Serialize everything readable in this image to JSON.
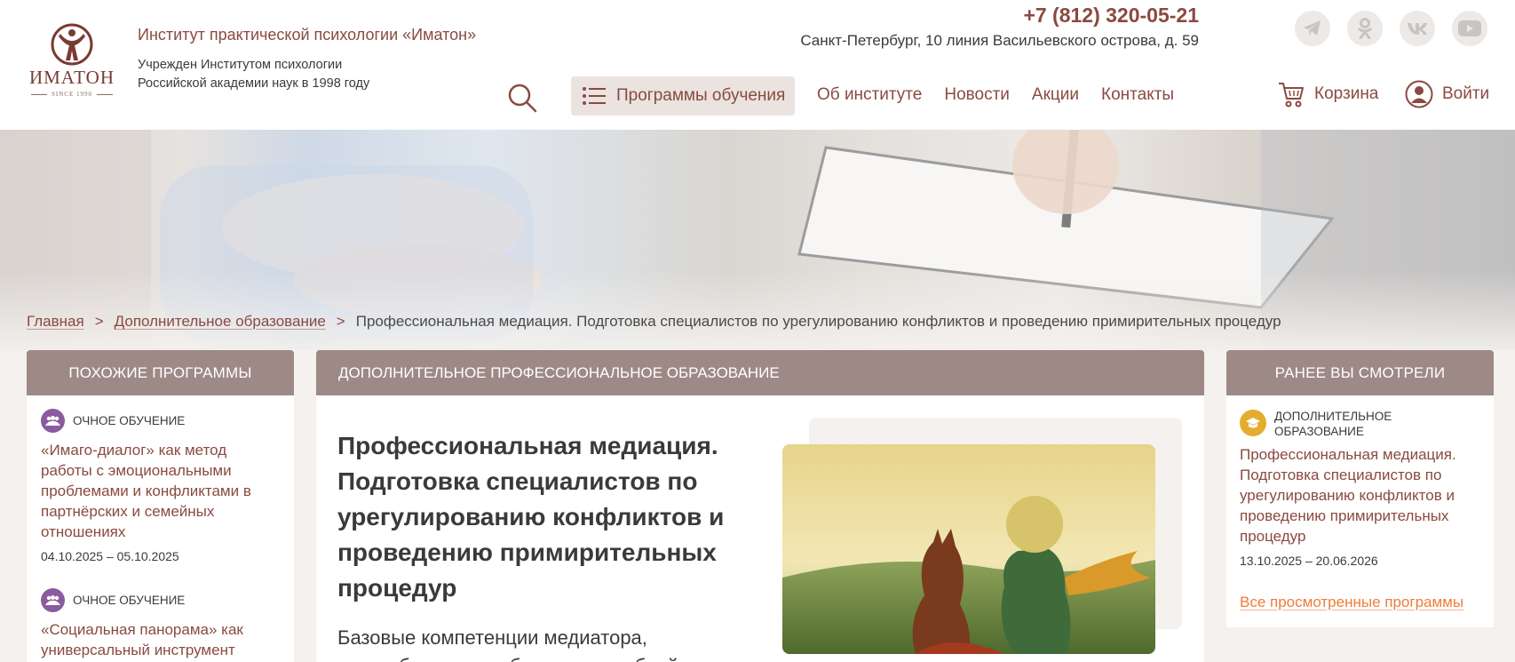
{
  "header": {
    "logo_text": "ИМАТОН",
    "logo_since": "SINCE 1990",
    "institute_name": "Институт практической психологии «Иматон»",
    "institute_sub": "Учрежден Институтом психологии Российской академии наук в 1998 году",
    "phone": "+7 (812) 320-05-21",
    "address": "Санкт-Петербург, 10 линия Васильевского острова, д. 59",
    "socials": [
      "telegram-icon",
      "odnoklassniki-icon",
      "vk-icon",
      "youtube-icon"
    ],
    "programs_label": "Программы обучения",
    "nav": [
      "Об институте",
      "Новости",
      "Акции",
      "Контакты"
    ],
    "cart_label": "Корзина",
    "login_label": "Войти"
  },
  "breadcrumb": {
    "home": "Главная",
    "section": "Дополнительное образование",
    "separator": ">",
    "current": "Профессиональная медиация. Подготовка специалистов по урегулированию конфликтов и проведению примирительных процедур"
  },
  "similar": {
    "heading": "ПОХОЖИЕ ПРОГРАММЫ",
    "items": [
      {
        "type": "ОЧНОЕ ОБУЧЕНИЕ",
        "title": "«Имаго-диалог» как метод работы с эмоциональными проблемами и конфликтами в партнёрских и семейных отношениях",
        "dates": "04.10.2025 – 05.10.2025"
      },
      {
        "type": "ОЧНОЕ ОБУЧЕНИЕ",
        "title": "«Социальная панорама» как универсальный инструмент"
      }
    ]
  },
  "main": {
    "category": "ДОПОЛНИТЕЛЬНОЕ ПРОФЕССИОНАЛЬНОЕ ОБРАЗОВАНИЕ",
    "title": "Профессиональная медиация. Подготовка специалистов по урегулированию конфликтов и проведению примирительных процедур",
    "description": "Базовые компетенции медиатора, востребованные в бизнесе, судебной"
  },
  "recent": {
    "heading": "РАНЕЕ ВЫ СМОТРЕЛИ",
    "item": {
      "type": "ДОПОЛНИТЕЛЬНОЕ ОБРАЗОВАНИЕ",
      "title": "Профессиональная медиация. Подготовка специалистов по урегулированию конфликтов и проведению примирительных процедур",
      "dates": "13.10.2025 – 20.06.2026"
    },
    "all_link": "Все просмотренные программы"
  },
  "colors": {
    "brand": "#8a4a40",
    "panel_header": "#9d8986",
    "accent_orange": "#ef7c3c",
    "icon_purple": "#8a5b9e",
    "icon_gold": "#e4ad30"
  }
}
